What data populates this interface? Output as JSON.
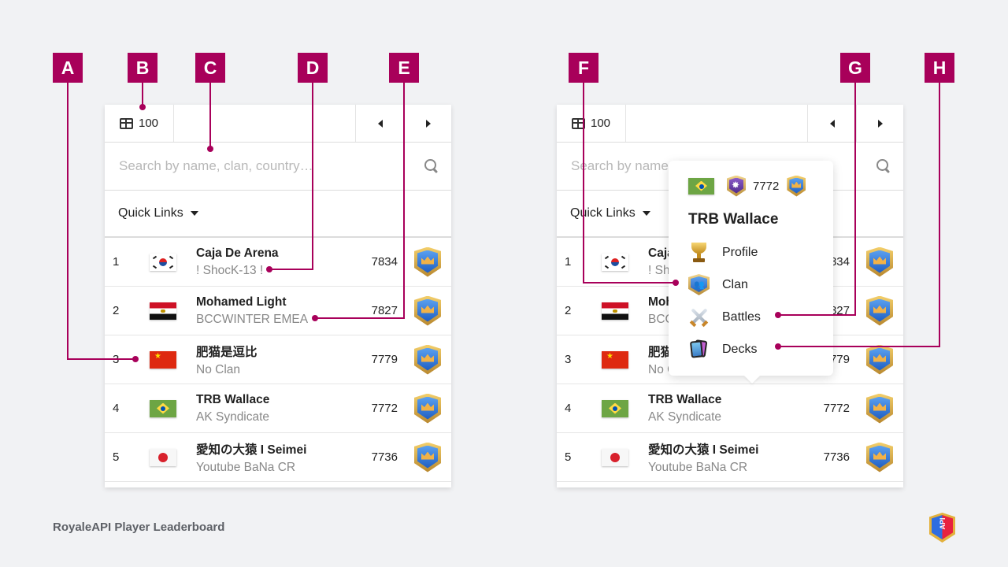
{
  "footer": {
    "title": "RoyaleAPI Player Leaderboard",
    "logo_text": "API"
  },
  "colors": {
    "accent": "#a8005a",
    "background": "#f1f2f4"
  },
  "callouts": [
    {
      "label": "A",
      "target": "rank"
    },
    {
      "label": "B",
      "target": "page-size"
    },
    {
      "label": "C",
      "target": "search"
    },
    {
      "label": "D",
      "target": "clan-name"
    },
    {
      "label": "E",
      "target": "clan-link"
    },
    {
      "label": "F",
      "target": "popover-clan"
    },
    {
      "label": "G",
      "target": "popover-battles"
    },
    {
      "label": "H",
      "target": "popover-decks"
    }
  ],
  "leaderboard": {
    "page_size": "100",
    "search_placeholder": "Search by name, clan, country…",
    "quick_links_label": "Quick Links",
    "players": [
      {
        "rank": "1",
        "country": "kr",
        "name": "Caja De Arena",
        "clan": "! ShocK-13 !",
        "trophies": "7834"
      },
      {
        "rank": "2",
        "country": "eg",
        "name": "Mohamed Light",
        "clan": "BCCWINTER EMEA",
        "trophies": "7827"
      },
      {
        "rank": "3",
        "country": "cn",
        "name": "肥猫是逗比",
        "clan": "No Clan",
        "trophies": "7779"
      },
      {
        "rank": "4",
        "country": "br",
        "name": "TRB Wallace",
        "clan": "AK Syndicate",
        "trophies": "7772"
      },
      {
        "rank": "5",
        "country": "jp",
        "name": "愛知の大猿 I Seimei",
        "clan": "Youtube BaNa CR",
        "trophies": "7736"
      }
    ]
  },
  "popover": {
    "country": "br",
    "trophies": "7772",
    "player_name": "TRB Wallace",
    "menu": [
      {
        "label": "Profile",
        "icon": "trophy-icon"
      },
      {
        "label": "Clan",
        "icon": "clan-badge-icon"
      },
      {
        "label": "Battles",
        "icon": "crossed-swords-icon"
      },
      {
        "label": "Decks",
        "icon": "cards-icon"
      }
    ]
  }
}
